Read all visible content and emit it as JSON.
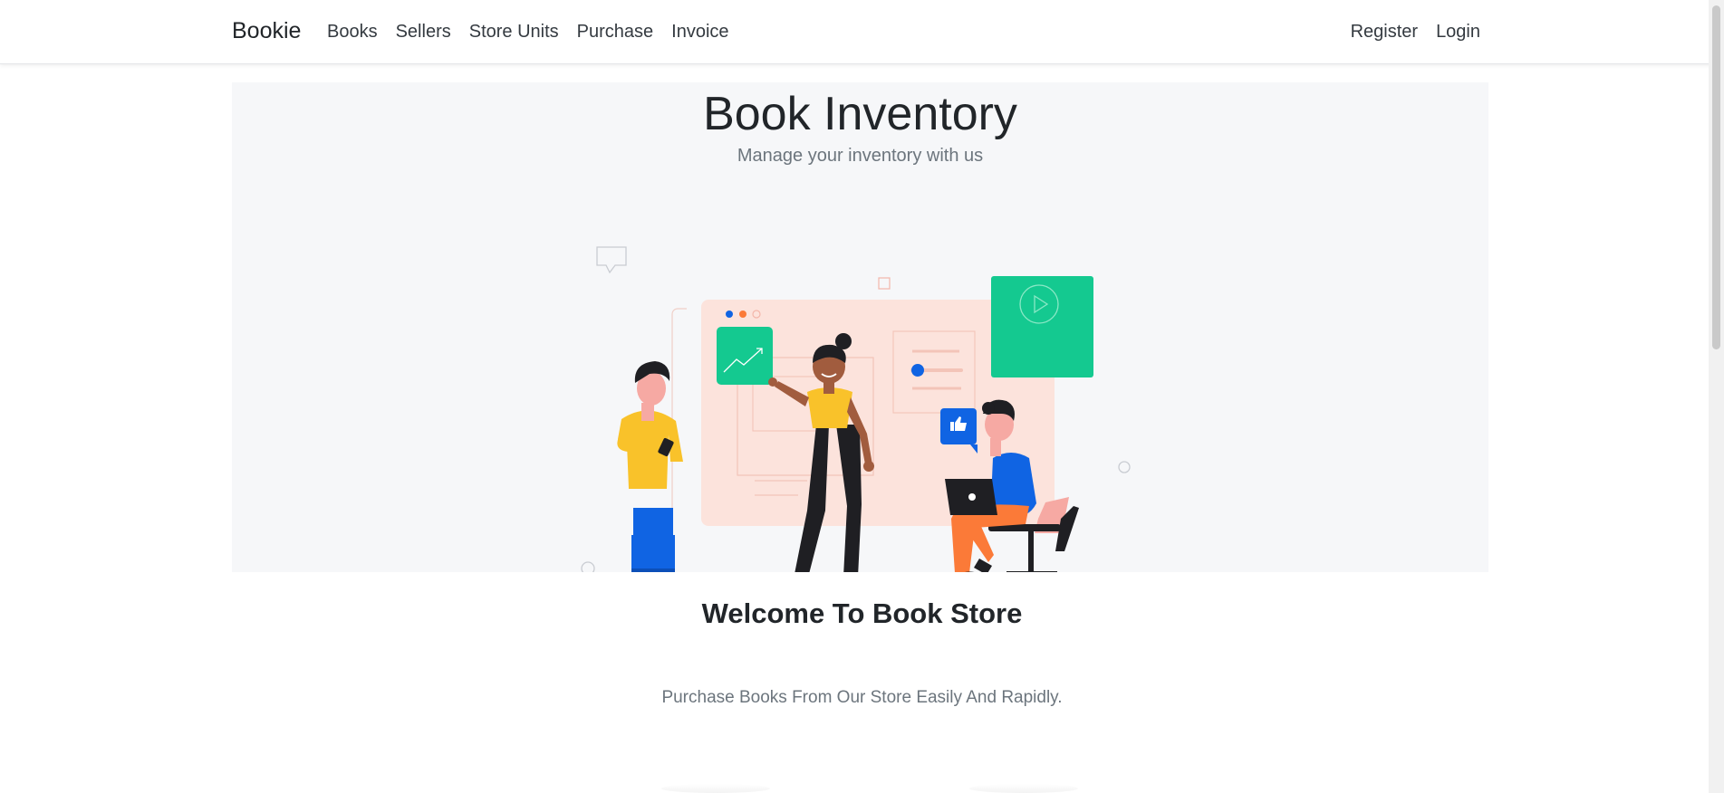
{
  "navbar": {
    "brand": "Bookie",
    "left_links": [
      "Books",
      "Sellers",
      "Store Units",
      "Purchase",
      "Invoice"
    ],
    "right_links": [
      "Register",
      "Login"
    ]
  },
  "hero": {
    "title": "Book Inventory",
    "subtitle": "Manage your inventory with us"
  },
  "welcome": {
    "heading": "Welcome To Book Store",
    "tagline": "Purchase Books From Our Store Easily And Rapidly."
  },
  "colors": {
    "green": "#14c990",
    "blue": "#1064e3",
    "yellow": "#f9c22a",
    "orange": "#fb7a38",
    "peach": "#fce3dc",
    "dark": "#1f1f23"
  }
}
